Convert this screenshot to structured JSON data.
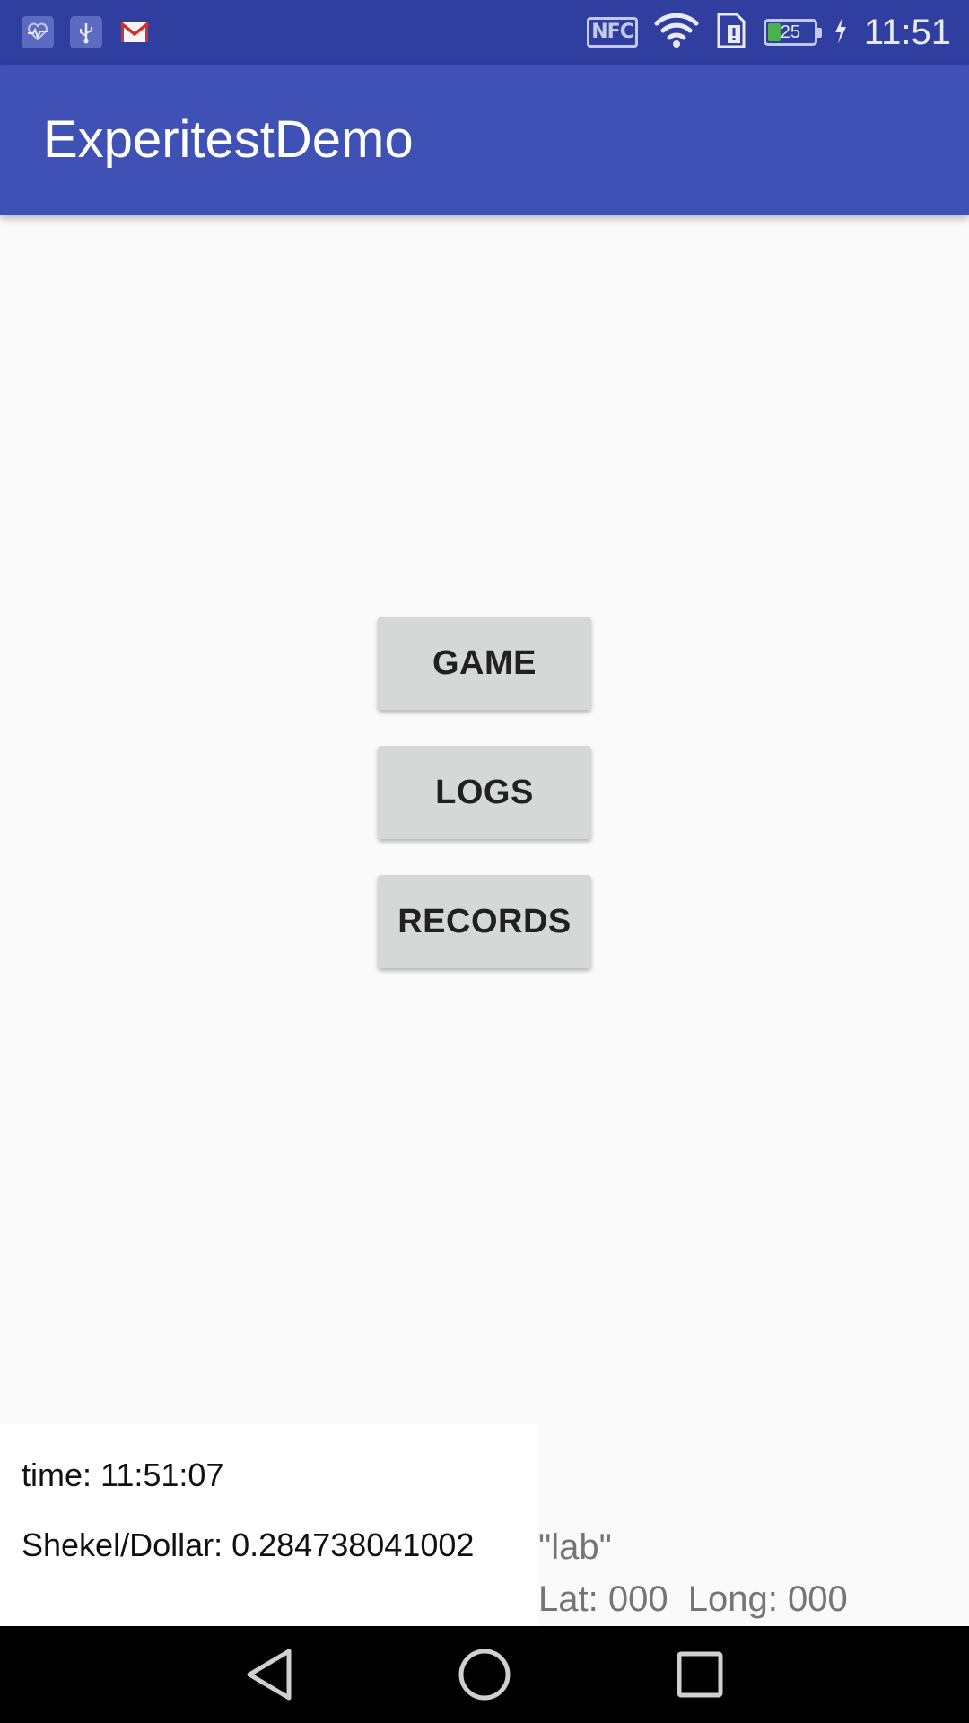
{
  "status_bar": {
    "left_icons": [
      "health-icon",
      "usb-icon",
      "gmail-icon"
    ],
    "nfc_label": "NFC",
    "battery_level": "25",
    "battery_charging": true,
    "time": "11:51"
  },
  "app_bar": {
    "title": "ExperitestDemo",
    "color": "#3f51b5"
  },
  "menu": {
    "game_label": "GAME",
    "logs_label": "LOGS",
    "records_label": "RECORDS"
  },
  "info": {
    "time_text": "time: 11:51:07",
    "rate_text": "Shekel/Dollar: 0.284738041002"
  },
  "location": {
    "name": "\"lab\"",
    "coords": "Lat: 000  Long: 000"
  },
  "nav_bar": {
    "buttons": [
      "back-icon",
      "home-icon",
      "recents-icon"
    ]
  }
}
